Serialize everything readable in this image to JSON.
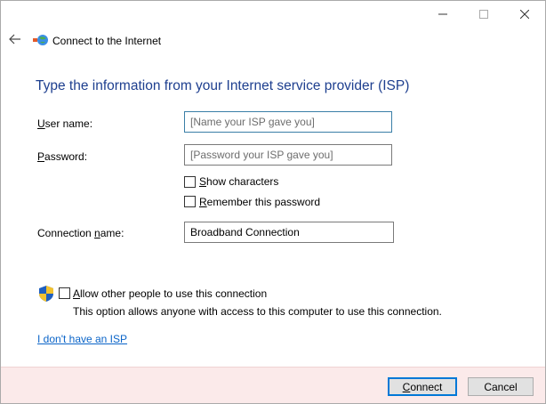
{
  "window": {
    "title": "Connect to the Internet",
    "controls": {
      "minimize_icon": "minimize-icon",
      "maximize_icon": "maximize-icon",
      "close_icon": "close-icon"
    }
  },
  "heading": "Type the information from your Internet service provider (ISP)",
  "form": {
    "username": {
      "label_first": "U",
      "label_rest": "ser name:",
      "placeholder": "[Name your ISP gave you]",
      "value": ""
    },
    "password": {
      "label_first": "P",
      "label_rest": "assword:",
      "placeholder": "[Password your ISP gave you]",
      "value": ""
    },
    "show_characters": {
      "label_first": "S",
      "label_rest": "how characters",
      "checked": false
    },
    "remember_password": {
      "label_first": "R",
      "label_rest": "emember this password",
      "checked": false
    },
    "connection_name": {
      "label_pre": "Connection ",
      "label_first": "n",
      "label_rest": "ame:",
      "value": "Broadband Connection"
    }
  },
  "allow_others": {
    "label_first": "A",
    "label_rest": "llow other people to use this connection",
    "description": "This option allows anyone with access to this computer to use this connection.",
    "checked": false
  },
  "no_isp_link": "I don't have an ISP",
  "buttons": {
    "connect": {
      "label_first": "C",
      "label_rest": "onnect"
    },
    "cancel": "Cancel"
  },
  "colors": {
    "heading": "#1e3f8f",
    "link": "#0a64c8",
    "footer": "#fbeaea",
    "default_button_border": "#0078d7"
  }
}
